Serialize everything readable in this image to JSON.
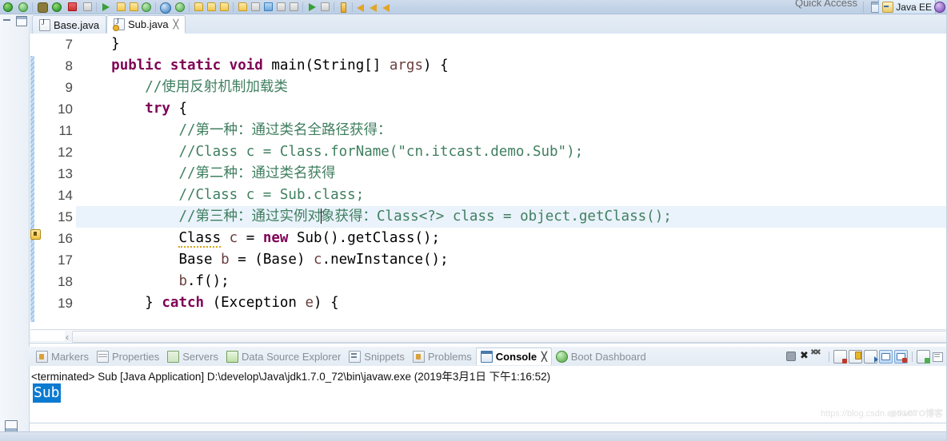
{
  "toolbar": {
    "quick_access": "Quick Access",
    "perspective_label": "Java EE",
    "icons": [
      "save-icon",
      "refresh-icon",
      "debug-icon",
      "run-icon",
      "stop-icon",
      "terminate-icon",
      "run-last-icon",
      "external-tools-icon",
      "new-java-project-icon",
      "new-package-icon",
      "new-class-icon",
      "search-icon",
      "open-type-icon",
      "open-folder-icon",
      "folder-icon",
      "warning-icon",
      "bookmark-icon",
      "marker-icon",
      "perspective-icon",
      "layout-icon",
      "next-annotation-icon",
      "previous-annotation-icon",
      "back-icon",
      "forward-icon"
    ]
  },
  "left_strip": {
    "minimize_icon": "minimize-icon",
    "restore_icon": "restore-icon",
    "bottom_restore_icon": "restore-view-icon"
  },
  "editor": {
    "tabs": [
      {
        "label": "Base.java",
        "active": false,
        "closable": false,
        "icon": "java-file-icon"
      },
      {
        "label": "Sub.java",
        "active": true,
        "closable": true,
        "close_glyph": "╳",
        "icon": "java-file-warning-icon"
      }
    ],
    "highlighted_line": 15,
    "warning_line": 16,
    "lines": [
      {
        "num": "7",
        "indent": 1,
        "tokens": [
          {
            "t": "}",
            "c": "plain"
          }
        ]
      },
      {
        "num": "8",
        "indent": 1,
        "tokens": [
          {
            "t": "public static void ",
            "c": "kw"
          },
          {
            "t": "main(String[] ",
            "c": "plain"
          },
          {
            "t": "args",
            "c": "param"
          },
          {
            "t": ") {",
            "c": "plain"
          }
        ]
      },
      {
        "num": "9",
        "indent": 2,
        "tokens": [
          {
            "t": "//使用反射机制加载类",
            "c": "cmt"
          }
        ]
      },
      {
        "num": "10",
        "indent": 2,
        "tokens": [
          {
            "t": "try",
            "c": "kw"
          },
          {
            "t": " {",
            "c": "plain"
          }
        ]
      },
      {
        "num": "11",
        "indent": 3,
        "tokens": [
          {
            "t": "//第一种：通过类名全路径获得：",
            "c": "cmt"
          }
        ]
      },
      {
        "num": "12",
        "indent": 3,
        "tokens": [
          {
            "t": "//Class c = Class.forName(\"cn.itcast.demo.Sub\");",
            "c": "cmt"
          }
        ]
      },
      {
        "num": "13",
        "indent": 3,
        "tokens": [
          {
            "t": "//第二种：通过类名获得",
            "c": "cmt"
          }
        ]
      },
      {
        "num": "14",
        "indent": 3,
        "tokens": [
          {
            "t": "//Class c = Sub.class;",
            "c": "cmt"
          }
        ]
      },
      {
        "num": "15",
        "indent": 3,
        "tokens": [
          {
            "t": "//第三种：通过实例对",
            "c": "cmt"
          },
          {
            "t": "",
            "c": "caret"
          },
          {
            "t": "象获得：Class<?> class = object.getClass();",
            "c": "cmt"
          }
        ]
      },
      {
        "num": "16",
        "indent": 3,
        "tokens": [
          {
            "t": "Class",
            "c": "warn"
          },
          {
            "t": " ",
            "c": "plain"
          },
          {
            "t": "c",
            "c": "local"
          },
          {
            "t": " = ",
            "c": "plain"
          },
          {
            "t": "new",
            "c": "kw"
          },
          {
            "t": " Sub().getClass();",
            "c": "plain"
          }
        ]
      },
      {
        "num": "17",
        "indent": 3,
        "tokens": [
          {
            "t": "Base ",
            "c": "plain"
          },
          {
            "t": "b",
            "c": "local"
          },
          {
            "t": " = (Base) ",
            "c": "plain"
          },
          {
            "t": "c",
            "c": "local"
          },
          {
            "t": ".newInstance();",
            "c": "plain"
          }
        ]
      },
      {
        "num": "18",
        "indent": 3,
        "tokens": [
          {
            "t": "b",
            "c": "local"
          },
          {
            "t": ".f();",
            "c": "plain"
          }
        ]
      },
      {
        "num": "19",
        "indent": 2,
        "tokens": [
          {
            "t": "} ",
            "c": "plain"
          },
          {
            "t": "catch",
            "c": "kw"
          },
          {
            "t": " (Exception ",
            "c": "plain"
          },
          {
            "t": "e",
            "c": "local"
          },
          {
            "t": ") {",
            "c": "plain"
          }
        ]
      }
    ],
    "hscroll_left_glyph": "‹"
  },
  "bottom_panel": {
    "tabs": [
      {
        "label": "Markers",
        "icon": "markers-icon",
        "active": false
      },
      {
        "label": "Properties",
        "icon": "properties-icon",
        "active": false
      },
      {
        "label": "Servers",
        "icon": "servers-icon",
        "active": false
      },
      {
        "label": "Data Source Explorer",
        "icon": "data-source-explorer-icon",
        "active": false
      },
      {
        "label": "Snippets",
        "icon": "snippets-icon",
        "active": false
      },
      {
        "label": "Problems",
        "icon": "problems-icon",
        "active": false
      },
      {
        "label": "Console",
        "icon": "console-icon",
        "active": true,
        "close_glyph": "╳"
      },
      {
        "label": "Boot Dashboard",
        "icon": "boot-dashboard-icon",
        "active": false
      }
    ],
    "toolbar_icons": [
      "terminate-icon",
      "remove-launch-icon",
      "remove-all-terminated-icon",
      "clear-console-icon",
      "scroll-lock-icon",
      "pin-console-icon",
      "display-selected-console-icon",
      "open-console-icon",
      "new-console-view-icon",
      "console-menu-icon"
    ],
    "console": {
      "launch_line": "<terminated> Sub [Java Application] D:\\develop\\Java\\jdk1.7.0_72\\bin\\javaw.exe (2019年3月1日 下午1:16:52)",
      "output_selected": "Sub"
    }
  },
  "watermark": {
    "url": "https://blog.csdn.net/wei",
    "brand": "@51CTO博客"
  },
  "colors": {
    "keyword": "#7f0055",
    "comment": "#3f7f5f",
    "selection": "#0b7ad1",
    "current_line": "#eaf2fb",
    "chrome": "#c3d3e7"
  }
}
